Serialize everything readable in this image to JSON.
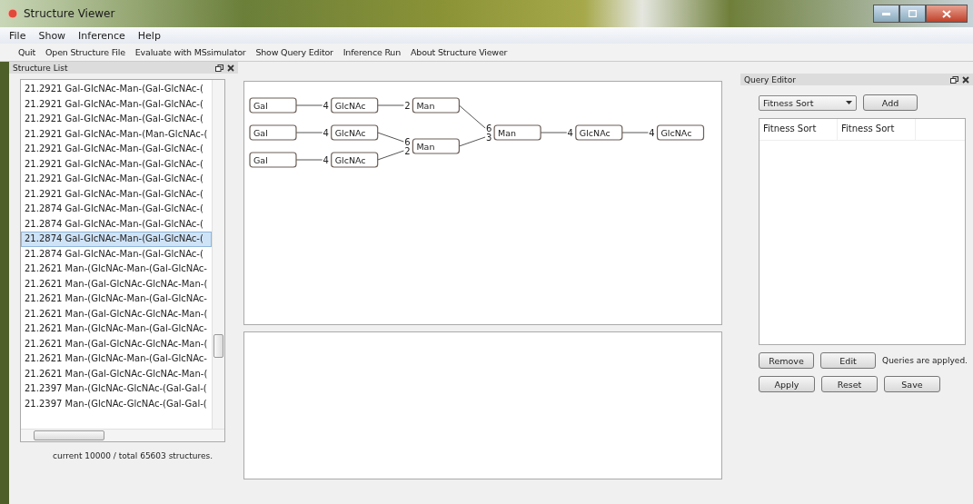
{
  "window": {
    "title": "Structure Viewer"
  },
  "menu": [
    "File",
    "Show",
    "Inference",
    "Help"
  ],
  "toolbar": [
    "Quit",
    "Open Structure File",
    "Evaluate with MSsimulator",
    "Show Query Editor",
    "Inference Run",
    "About Structure Viewer"
  ],
  "structure_list": {
    "title": "Structure List",
    "items": [
      {
        "text": "21.2921 Gal-GlcNAc-Man-(Gal-GlcNAc-(",
        "selected": false
      },
      {
        "text": "21.2921 Gal-GlcNAc-Man-(Gal-GlcNAc-(",
        "selected": false
      },
      {
        "text": "21.2921 Gal-GlcNAc-Man-(Gal-GlcNAc-(",
        "selected": false
      },
      {
        "text": "21.2921 Gal-GlcNAc-Man-(Man-GlcNAc-(",
        "selected": false
      },
      {
        "text": "21.2921 Gal-GlcNAc-Man-(Gal-GlcNAc-(",
        "selected": false
      },
      {
        "text": "21.2921 Gal-GlcNAc-Man-(Gal-GlcNAc-(",
        "selected": false
      },
      {
        "text": "21.2921 Gal-GlcNAc-Man-(Gal-GlcNAc-(",
        "selected": false
      },
      {
        "text": "21.2921 Gal-GlcNAc-Man-(Gal-GlcNAc-(",
        "selected": false
      },
      {
        "text": "21.2874 Gal-GlcNAc-Man-(Gal-GlcNAc-(",
        "selected": false
      },
      {
        "text": "21.2874 Gal-GlcNAc-Man-(Gal-GlcNAc-(",
        "selected": false
      },
      {
        "text": "21.2874 Gal-GlcNAc-Man-(Gal-GlcNAc-(",
        "selected": true
      },
      {
        "text": "21.2874 Gal-GlcNAc-Man-(Gal-GlcNAc-(",
        "selected": false
      },
      {
        "text": "21.2621 Man-(GlcNAc-Man-(Gal-GlcNAc-",
        "selected": false
      },
      {
        "text": "21.2621 Man-(Gal-GlcNAc-GlcNAc-Man-(",
        "selected": false
      },
      {
        "text": "21.2621 Man-(GlcNAc-Man-(Gal-GlcNAc-",
        "selected": false
      },
      {
        "text": "21.2621 Man-(Gal-GlcNAc-GlcNAc-Man-(",
        "selected": false
      },
      {
        "text": "21.2621 Man-(GlcNAc-Man-(Gal-GlcNAc-",
        "selected": false
      },
      {
        "text": "21.2621 Man-(Gal-GlcNAc-GlcNAc-Man-(",
        "selected": false
      },
      {
        "text": "21.2621 Man-(GlcNAc-Man-(Gal-GlcNAc-",
        "selected": false
      },
      {
        "text": "21.2621 Man-(Gal-GlcNAc-GlcNAc-Man-(",
        "selected": false
      },
      {
        "text": "21.2397 Man-(GlcNAc-GlcNAc-(Gal-Gal-(",
        "selected": false
      },
      {
        "text": "21.2397 Man-(GlcNAc-GlcNAc-(Gal-Gal-(",
        "selected": false
      }
    ],
    "status": "current 10000 / total 65603 structures."
  },
  "diagram": {
    "root": {
      "label": "GlcNAc",
      "children": [
        {
          "label": "GlcNAc",
          "linkage": "4",
          "children": [
            {
              "label": "Man",
              "linkage": "4",
              "children": [
                {
                  "label": "Man",
                  "linkage": "6",
                  "children": [
                    {
                      "label": "GlcNAc",
                      "linkage": "2",
                      "children": [
                        {
                          "label": "Gal",
                          "linkage": "4"
                        }
                      ]
                    }
                  ]
                },
                {
                  "label": "Man",
                  "linkage": "3",
                  "children": [
                    {
                      "label": "GlcNAc",
                      "linkage": "6",
                      "children": [
                        {
                          "label": "Gal",
                          "linkage": "4"
                        }
                      ]
                    },
                    {
                      "label": "GlcNAc",
                      "linkage": "2",
                      "children": [
                        {
                          "label": "Gal",
                          "linkage": "4"
                        }
                      ]
                    }
                  ]
                }
              ]
            }
          ]
        }
      ]
    }
  },
  "query_editor": {
    "title": "Query Editor",
    "select": {
      "value": "Fitness Sort"
    },
    "add_button": "Add",
    "rows": [
      [
        "Fitness Sort",
        "Fitness Sort"
      ]
    ],
    "buttons_row_1": [
      "Remove",
      "Edit"
    ],
    "status": "Queries are applyed.",
    "buttons_row_2": [
      "Apply",
      "Reset",
      "Save"
    ]
  }
}
